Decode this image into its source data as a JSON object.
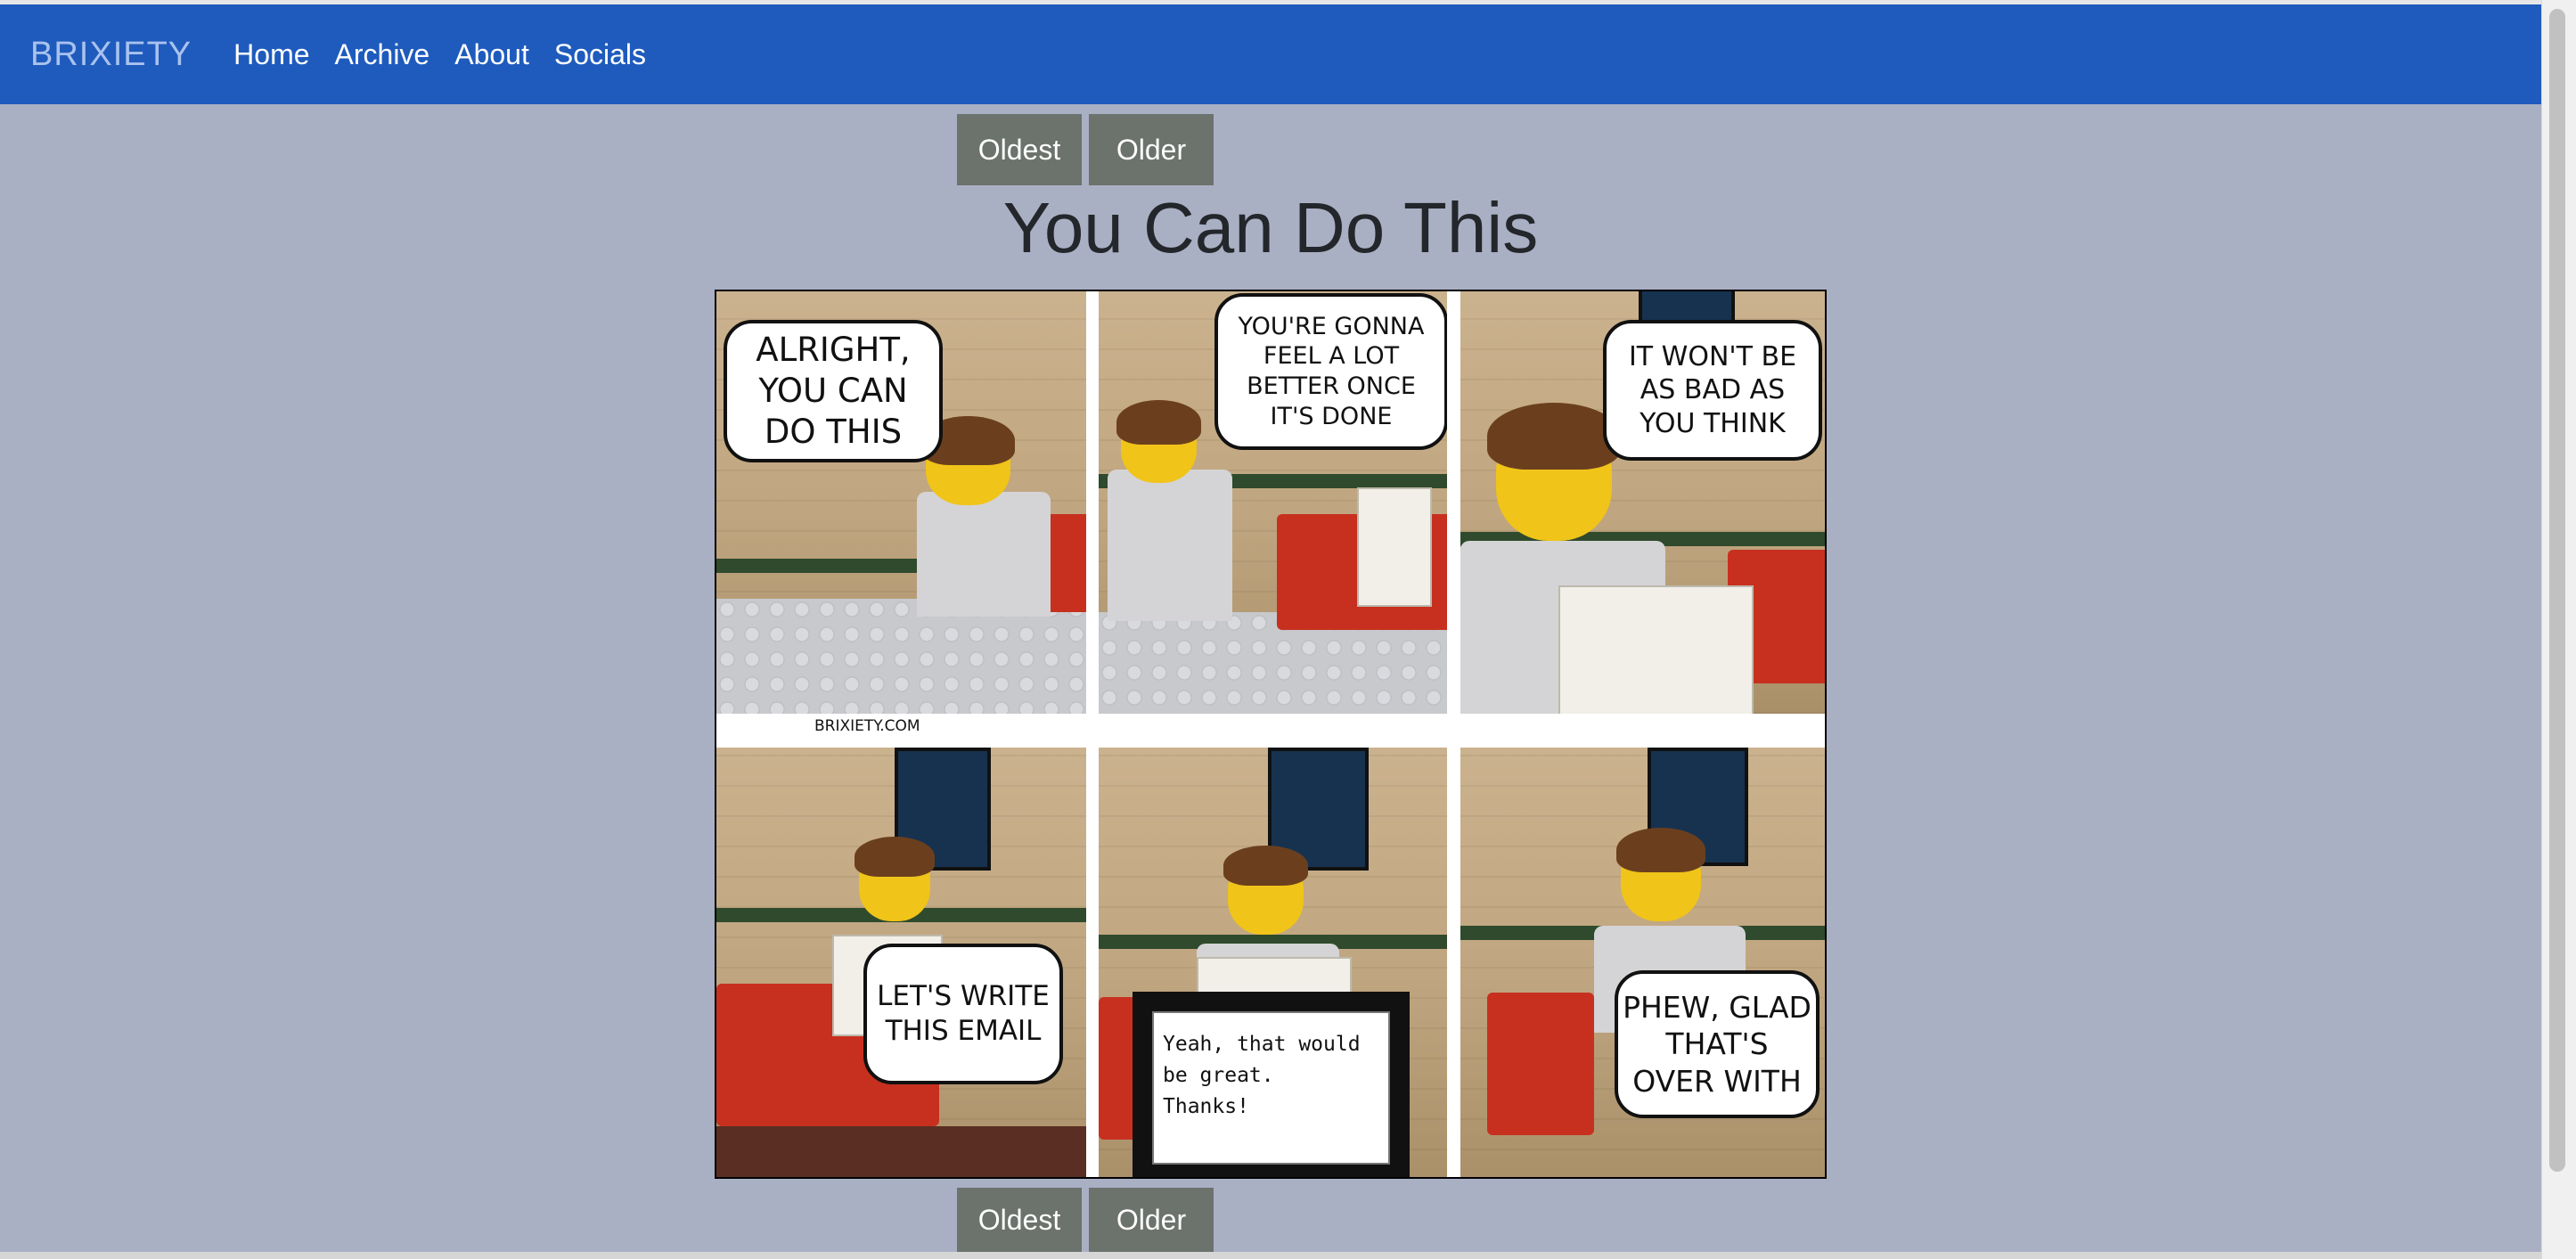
{
  "nav": {
    "brand": "BRIXIETY",
    "links": [
      "Home",
      "Archive",
      "About",
      "Socials"
    ]
  },
  "pager_top": {
    "oldest": "Oldest",
    "older": "Older"
  },
  "pager_bottom": {
    "oldest": "Oldest",
    "older": "Older"
  },
  "comic": {
    "title": "You Can Do This",
    "watermark": "BRIXIETY.COM",
    "bubbles": [
      "ALRIGHT,\nYOU CAN\nDO THIS",
      "YOU'RE GONNA\nFEEL A LOT\nBETTER ONCE\nIT'S DONE",
      "IT WON'T BE\nAS BAD AS\nYOU THINK",
      "LET'S WRITE\nTHIS EMAIL",
      "PHEW, GLAD\nTHAT'S\nOVER WITH"
    ],
    "screen_text": "Yeah, that would\nbe great.\nThanks!"
  }
}
